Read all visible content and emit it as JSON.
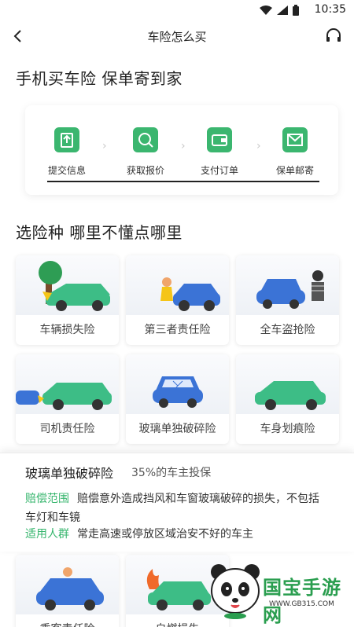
{
  "status": {
    "time": "10:35"
  },
  "nav": {
    "title": "车险怎么买"
  },
  "section1": {
    "heading": "手机买车险 保单寄到家"
  },
  "steps": [
    {
      "label": "提交信息",
      "icon": "upload-icon"
    },
    {
      "label": "获取报价",
      "icon": "quote-icon"
    },
    {
      "label": "支付订单",
      "icon": "wallet-icon"
    },
    {
      "label": "保单邮寄",
      "icon": "mail-icon"
    }
  ],
  "section2": {
    "heading": "选险种 哪里不懂点哪里"
  },
  "insurance": [
    {
      "label": "车辆损失险"
    },
    {
      "label": "第三者责任险"
    },
    {
      "label": "全车盗抢险"
    },
    {
      "label": "司机责任险"
    },
    {
      "label": "玻璃单独破碎险"
    },
    {
      "label": "车身划痕险"
    },
    {
      "label": "乘客责任险"
    },
    {
      "label": "自燃损失"
    }
  ],
  "detail": {
    "title": "玻璃单独破碎险",
    "subtitle": "35%的车主投保",
    "scope_tag": "赔偿范围",
    "scope_text": "赔偿意外造成挡风和车窗玻璃破碎的损失，不包括车灯和车镜",
    "people_tag": "适用人群",
    "people_text": "常走高速或停放区域治安不好的车主"
  },
  "watermark": {
    "brand": "国宝手游网",
    "url": "WWW.GB315.COM"
  },
  "colors": {
    "accent": "#35b56c",
    "car_green": "#3dbd86",
    "car_blue": "#3b73d6"
  }
}
